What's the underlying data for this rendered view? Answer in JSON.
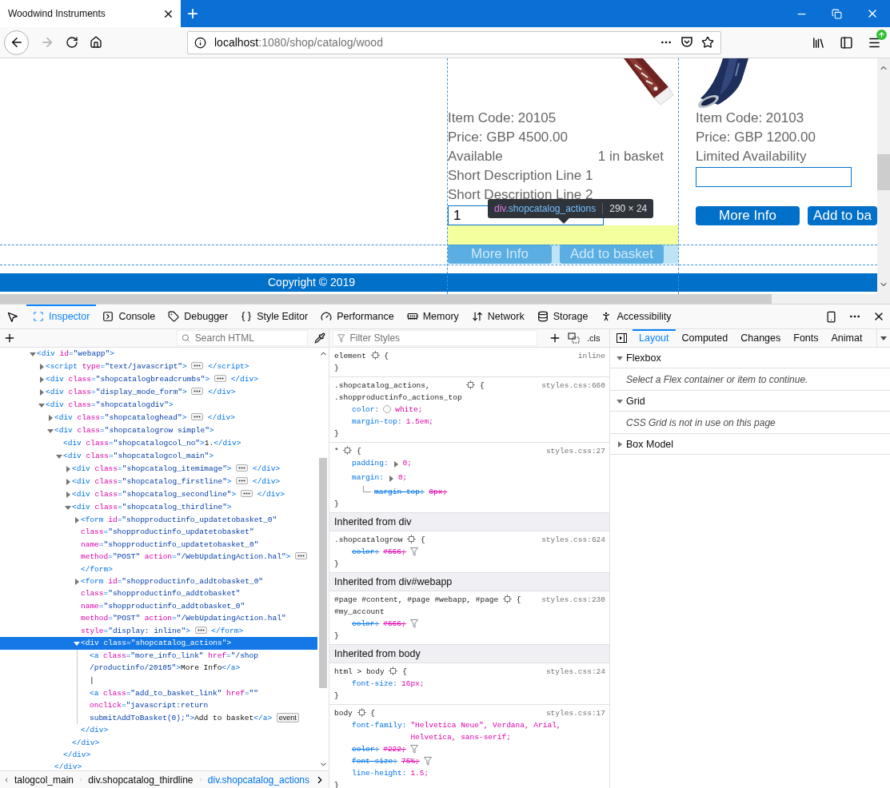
{
  "browser": {
    "tab_title": "Woodwind Instruments",
    "new_tab": "+",
    "url_host": "localhost",
    "url_path": ":1080/shop/catalog/wood"
  },
  "page": {
    "products": [
      {
        "lines": [
          "Item Code: 20105",
          "Price: GBP 4500.00"
        ],
        "availability": "Available",
        "basket": "1 in basket",
        "descriptions": [
          "Short Description Line 1",
          "Short Description Line 2"
        ],
        "quantity": "1",
        "buttons": [
          "More Info",
          "Add to basket"
        ],
        "highlighted": true
      },
      {
        "lines": [
          "Item Code: 20103",
          "Price: GBP 1200.00"
        ],
        "availability": "Limited Availability",
        "buttons": [
          "More Info",
          "Add to ba"
        ],
        "highlighted": false
      }
    ],
    "footer": "Copyright © 2019",
    "tooltip": {
      "tag": "div",
      "class": ".shopcatalog_actions",
      "size": "290 × 24"
    }
  },
  "devtools": {
    "tabs": [
      {
        "label": "Inspector",
        "selected": true
      },
      {
        "label": "Console",
        "selected": false
      },
      {
        "label": "Debugger",
        "selected": false
      },
      {
        "label": "Style Editor",
        "selected": false
      },
      {
        "label": "Performance",
        "selected": false
      },
      {
        "label": "Memory",
        "selected": false
      },
      {
        "label": "Network",
        "selected": false
      },
      {
        "label": "Storage",
        "selected": false
      },
      {
        "label": "Accessibility",
        "selected": false
      }
    ]
  },
  "markup": {
    "search_placeholder": "Search HTML",
    "tree": [
      {
        "lines": [
          "<div id=\"webapp\">"
        ],
        "expanded": true,
        "selected": false,
        "children": [
          {
            "lines": [
              "<script type=\"text/javascript\">"
            ],
            "expanded": false,
            "selected": false,
            "close": "</script>"
          },
          {
            "lines": [
              "<div class=\"shopcatalogbreadcrumbs\">"
            ],
            "expanded": false,
            "selected": false,
            "close": "</div>"
          },
          {
            "lines": [
              "<div class=\"display_mode_form\">"
            ],
            "expanded": false,
            "selected": false,
            "close": "</div>"
          },
          {
            "lines": [
              "<div class=\"shopcatalogdiv\">"
            ],
            "expanded": true,
            "selected": false,
            "children": [
              {
                "lines": [
                  "<div class=\"shopcataloghead\">"
                ],
                "expanded": false,
                "selected": false,
                "close": "</div>"
              },
              {
                "lines": [
                  "<div class=\"shopcatalogrow simple\">"
                ],
                "expanded": true,
                "selected": false,
                "close": "</div>",
                "children": [
                  {
                    "lines": [
                      "<div class=\"shopcatalogcol_no\">1.</div>"
                    ],
                    "selected": false
                  },
                  {
                    "lines": [
                      "<div class=\"shopcatalogcol_main\">"
                    ],
                    "expanded": true,
                    "selected": false,
                    "close": "</div>",
                    "children": [
                      {
                        "lines": [
                          "<div class=\"shopcatalog_itemimage\">"
                        ],
                        "expanded": false,
                        "selected": false,
                        "close": "</div>"
                      },
                      {
                        "lines": [
                          "<div class=\"shopcatalog_firstline\">"
                        ],
                        "expanded": false,
                        "selected": false,
                        "close": "</div>"
                      },
                      {
                        "lines": [
                          "<div class=\"shopcatalog_secondline\">"
                        ],
                        "expanded": false,
                        "selected": false,
                        "close": "</div>"
                      },
                      {
                        "lines": [
                          "<div class=\"shopcatalog_thirdline\">"
                        ],
                        "expanded": true,
                        "selected": false,
                        "close": "</div>",
                        "children": [
                          {
                            "lines": [
                              "<form id=\"shopproductinfo_updatetobasket_0\"",
                              "class=\"shopproductinfo_updatetobasket\"",
                              "name=\"shopproductinfo_updatetobasket_0\"",
                              "method=\"POST\" action=\"/WebUpdatingAction.hal\">"
                            ],
                            "expanded": false,
                            "selected": false,
                            "close": "</form>"
                          },
                          {
                            "lines": [
                              "<form id=\"shopproductinfo_addtobasket_0\"",
                              "class=\"shopproductinfo_addtobasket\"",
                              "name=\"shopproductinfo_addtobasket_0\"",
                              "method=\"POST\" action=\"/WebUpdatingAction.hal\"",
                              "style=\"display: inline\">"
                            ],
                            "expanded": false,
                            "selected": false,
                            "close": "</form>"
                          },
                          {
                            "lines": [
                              "<div class=\"shopcatalog_actions\">"
                            ],
                            "expanded": true,
                            "selected": true,
                            "close": "</div>",
                            "children": [
                              {
                                "lines": [
                                  "<a class=\"more_info_link\" href=\"/shop",
                                  "/productinfo/20105\">More Info</a>"
                                ],
                                "selected": false
                              },
                              {
                                "lines": [
                                  "|"
                                ],
                                "selected": false
                              },
                              {
                                "lines": [
                                  "<a class=\"add_to_basket_link\" href=\"\"",
                                  "onclick=\"javascript:return",
                                  "submitAddToBasket(0);\">Add to basket</a>"
                                ],
                                "badge": "event",
                                "selected": false
                              }
                            ]
                          }
                        ]
                      }
                    ]
                  }
                ]
              }
            ]
          }
        ]
      }
    ],
    "breadcrumbs": [
      {
        "label": "talogcol_main",
        "selected": false
      },
      {
        "label": "div.shopcatalog_thirdline",
        "selected": false
      },
      {
        "label": "div.shopcatalog_actions",
        "selected": true
      }
    ]
  },
  "styles": {
    "filter_placeholder": "Filter Styles",
    "class_toggle": ".cls",
    "rules": [
      {
        "kind": "rule",
        "selector": [
          "element"
        ],
        "open": "{",
        "close": "}",
        "source": "inline"
      },
      {
        "kind": "rule",
        "selector": [
          ".shopcatalog_actions,",
          ".shopproductinfo_actions_top"
        ],
        "open": "{",
        "close": "}",
        "source": "styles.css:660",
        "declarations": [
          {
            "name": "color:",
            "value": "white;",
            "color": "#ffffff",
            "expandable": false,
            "overridden": false
          },
          {
            "name": "margin-top:",
            "value": "1.5em;",
            "expandable": false,
            "overridden": false
          }
        ]
      },
      {
        "kind": "rule",
        "selector": [
          "*"
        ],
        "open": "{",
        "close": "}",
        "source": "styles.css:27",
        "declarations": [
          {
            "name": "padding:",
            "value": "0;",
            "expandable": true,
            "overridden": false
          },
          {
            "name": "margin:",
            "value": "0;",
            "expandable": true,
            "overridden": false,
            "sub": [
              {
                "name": "margin-top:",
                "value": "0px;",
                "overridden": true
              }
            ]
          }
        ]
      },
      {
        "kind": "header",
        "text": "Inherited from div"
      },
      {
        "kind": "rule",
        "selector": [
          ".shopcatalogrow"
        ],
        "open": "{",
        "close": "}",
        "source": "styles.css:624",
        "declarations": [
          {
            "name": "color:",
            "value": "#666;",
            "expandable": false,
            "overridden": true
          }
        ]
      },
      {
        "kind": "header",
        "text": "Inherited from div#webapp"
      },
      {
        "kind": "rule",
        "selector": [
          "#page #content, #page #webapp, #page",
          "#my_account"
        ],
        "open": "{",
        "close": "}",
        "source": "styles.css:230",
        "declarations": [
          {
            "name": "color:",
            "value": "#666;",
            "expandable": false,
            "overridden": true
          }
        ]
      },
      {
        "kind": "header",
        "text": "Inherited from body"
      },
      {
        "kind": "rule",
        "selector": [
          "html > body"
        ],
        "open": "{",
        "close": "}",
        "source": "styles.css:24",
        "declarations": [
          {
            "name": "font-size:",
            "value": "16px;",
            "expandable": false,
            "overridden": false
          }
        ]
      },
      {
        "kind": "rule",
        "selector": [
          "body"
        ],
        "open": "{",
        "close": "}",
        "source": "styles.css:17",
        "declarations": [
          {
            "name": "font-family:",
            "value": "\"Helvetica Neue\", Verdana, Arial, Helvetica, sans-serif;",
            "expandable": false,
            "overridden": false
          },
          {
            "name": "color:",
            "value": "#222;",
            "expandable": false,
            "overridden": true
          },
          {
            "name": "font-size:",
            "value": "75%;",
            "expandable": false,
            "overridden": true
          },
          {
            "name": "line-height:",
            "value": "1.5;",
            "expandable": false,
            "overridden": false
          }
        ]
      }
    ]
  },
  "sidebar": {
    "tabs": [
      {
        "label": "Layout",
        "selected": true
      },
      {
        "label": "Computed",
        "selected": false
      },
      {
        "label": "Changes",
        "selected": false
      },
      {
        "label": "Fonts",
        "selected": false
      },
      {
        "label": "Animat",
        "selected": false
      }
    ],
    "sections": [
      {
        "title": "Flexbox",
        "expanded": true,
        "message": "Select a Flex container or item to continue."
      },
      {
        "title": "Grid",
        "expanded": true,
        "message": "CSS Grid is not in use on this page"
      },
      {
        "title": "Box Model",
        "expanded": false
      }
    ]
  }
}
